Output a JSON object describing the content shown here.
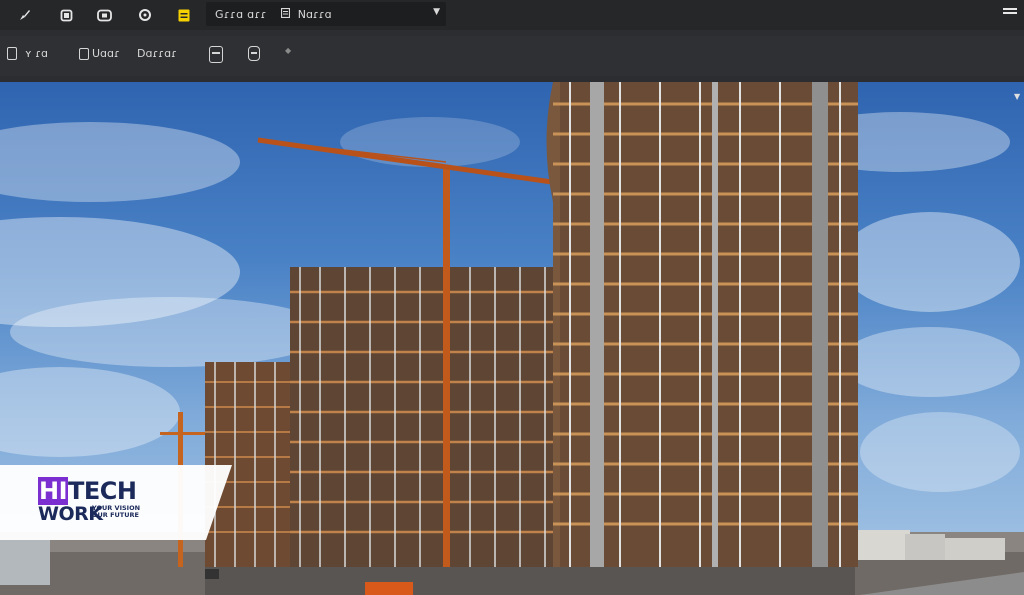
{
  "toolbar": {
    "icons": [
      "brush-tool-icon",
      "square-tool-icon",
      "box-tool-icon",
      "cycle-icon",
      "note-icon"
    ],
    "accent": "#f5d100",
    "combo": {
      "label": "Gɾɾɑ ɑɾɾ",
      "name": "Nɑɾɾɑ"
    }
  },
  "toolbar2": {
    "item1": "ʏ ɾɑ",
    "item2": "Uɑɑɾ",
    "item3": "Dɑɾɾɑɾ"
  },
  "watermark": {
    "hi": "HI",
    "tech": "TECH",
    "work": "WORK",
    "tagline1": "YOUR VISION",
    "tagline2": "OUR FUTURE",
    "brand_color": "#7b2fd1",
    "navy": "#1b2a5a"
  }
}
